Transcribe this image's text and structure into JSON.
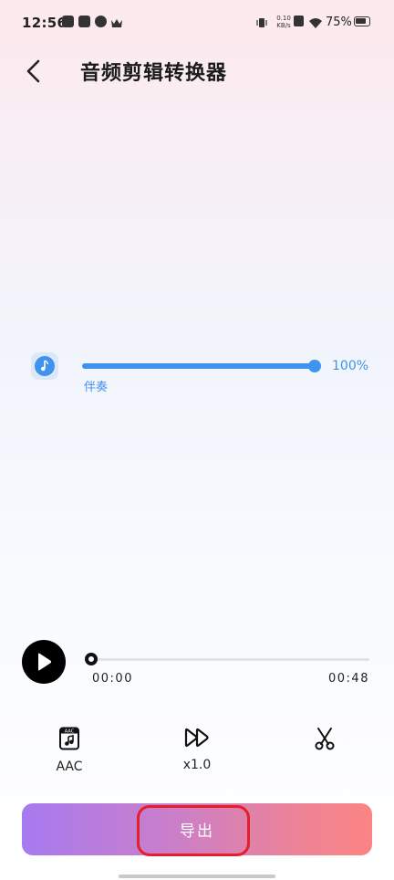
{
  "status_bar": {
    "time": "12:56",
    "net_speed_value": "0.10",
    "net_speed_unit": "KB/s",
    "battery": "75%"
  },
  "header": {
    "title": "音频剪辑转换器",
    "back_icon": "chevron-left-icon"
  },
  "track": {
    "name": "伴奏",
    "volume": "100%",
    "volume_fraction": 1.0,
    "icon": "music-note-icon",
    "accent_color": "#3f93ec"
  },
  "player": {
    "current_time": "00:00",
    "total_time": "00:48",
    "progress_fraction": 0.0,
    "play_icon": "play-icon"
  },
  "tools": {
    "format_label": "AAC",
    "format_icon_text": "AAC",
    "speed_label": "x1.0",
    "cut_icon": "scissors-icon"
  },
  "export": {
    "label": "导出",
    "highlight_color": "#e61e2a"
  }
}
